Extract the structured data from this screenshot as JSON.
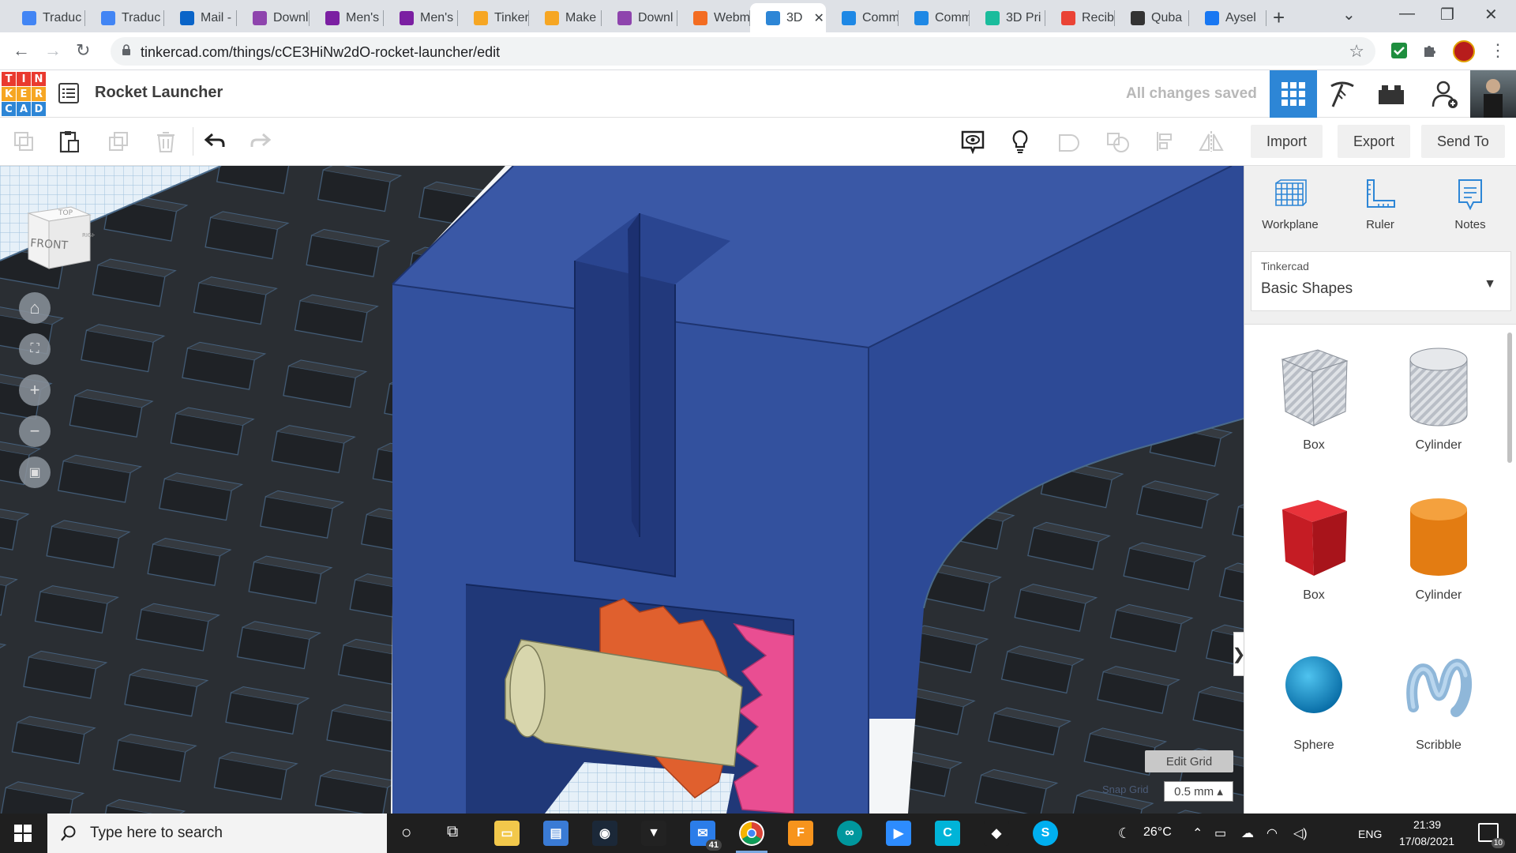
{
  "browser": {
    "tabs": [
      {
        "label": "Traduc",
        "icon": "google-translate-icon",
        "color": "#4285f4"
      },
      {
        "label": "Traduc",
        "icon": "google-translate-icon",
        "color": "#4285f4"
      },
      {
        "label": "Mail -",
        "icon": "outlook-icon",
        "color": "#0a64c8"
      },
      {
        "label": "Downl",
        "icon": "download-site-icon",
        "color": "#8e44ad"
      },
      {
        "label": "Men's",
        "icon": "shop-bag-icon",
        "color": "#7b1fa2"
      },
      {
        "label": "Men's",
        "icon": "shop-bag-icon",
        "color": "#7b1fa2"
      },
      {
        "label": "Tinker",
        "icon": "instructables-icon",
        "color": "#f6a623"
      },
      {
        "label": "Make",
        "icon": "instructables-icon",
        "color": "#f6a623"
      },
      {
        "label": "Downl",
        "icon": "download-site-icon",
        "color": "#8e44ad"
      },
      {
        "label": "Webm",
        "icon": "cpanel-icon",
        "color": "#f36c21"
      },
      {
        "label": "3D",
        "icon": "tinkercad-icon",
        "color": "#2d86d6"
      },
      {
        "label": "Comm",
        "icon": "tinkercad-community-icon",
        "color": "#1e88e5"
      },
      {
        "label": "Comm",
        "icon": "tinkercad-community-icon",
        "color": "#1e88e5"
      },
      {
        "label": "3D Pri",
        "icon": "thingiverse-icon",
        "color": "#1abc9c"
      },
      {
        "label": "Recibi",
        "icon": "gmail-icon",
        "color": "#ea4335"
      },
      {
        "label": "Quba",
        "icon": "wikipedia-icon",
        "color": "#333333"
      },
      {
        "label": "Aysel",
        "icon": "facebook-icon",
        "color": "#1877f2"
      }
    ],
    "active_tab_index": 10,
    "url": "tinkercad.com/things/cCE3HiNw2dO-rocket-launcher/edit"
  },
  "app": {
    "design_title": "Rocket Launcher",
    "save_status": "All changes saved",
    "logo_letters": [
      "T",
      "I",
      "N",
      "K",
      "E",
      "R",
      "C",
      "A",
      "D"
    ],
    "logo_colors": [
      "#e93a2f",
      "#e93a2f",
      "#e93a2f",
      "#f6a623",
      "#f6a623",
      "#f6a623",
      "#2d86d6",
      "#2d86d6",
      "#2d86d6"
    ],
    "accent": "#2d86d6"
  },
  "toolbar": {
    "import_label": "Import",
    "export_label": "Export",
    "send_to_label": "Send To"
  },
  "viewport": {
    "viewcube_top": "TOP",
    "viewcube_front": "FRONT",
    "viewcube_right": "RIGHT",
    "edit_grid_label": "Edit Grid",
    "snap_grid_label": "Snap Grid",
    "snap_grid_value": "0.5 mm ▴"
  },
  "panel": {
    "tools": [
      {
        "label": "Workplane",
        "icon": "workplane-icon"
      },
      {
        "label": "Ruler",
        "icon": "ruler-icon"
      },
      {
        "label": "Notes",
        "icon": "notes-icon"
      }
    ],
    "library_source": "Tinkercad",
    "library_name": "Basic Shapes",
    "shapes": [
      {
        "label": "Box",
        "kind": "box-hole"
      },
      {
        "label": "Cylinder",
        "kind": "cylinder-hole"
      },
      {
        "label": "Box",
        "kind": "box-solid"
      },
      {
        "label": "Cylinder",
        "kind": "cylinder-solid"
      },
      {
        "label": "Sphere",
        "kind": "sphere"
      },
      {
        "label": "Scribble",
        "kind": "scribble"
      }
    ]
  },
  "taskbar": {
    "search_placeholder": "Type here to search",
    "mail_badge": "41",
    "weather": "26°C",
    "language": "ENG",
    "time": "21:39",
    "date": "17/08/2021",
    "notification_count": "10"
  }
}
